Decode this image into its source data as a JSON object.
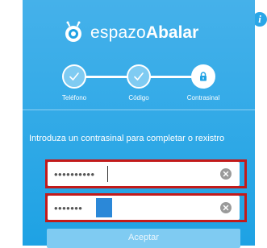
{
  "brand": {
    "name_part1": "espazo",
    "name_part2": "Abalar"
  },
  "info_icon": "i",
  "steps": [
    {
      "label": "Teléfono",
      "state": "done",
      "icon": "check-icon"
    },
    {
      "label": "Código",
      "state": "done",
      "icon": "check-icon"
    },
    {
      "label": "Contrasinal",
      "state": "current",
      "icon": "lock-icon"
    }
  ],
  "form": {
    "instruction": "Introduza un contrasinal para completar o rexistro",
    "password_value": "••••••••••",
    "confirm_value": "•••••••",
    "accept_label": "Aceptar"
  },
  "colors": {
    "panel": "#1ea2e4",
    "step_done": "#7fcbf2",
    "highlight": "#c21a1a",
    "drag_handle": "#2b88d8"
  }
}
